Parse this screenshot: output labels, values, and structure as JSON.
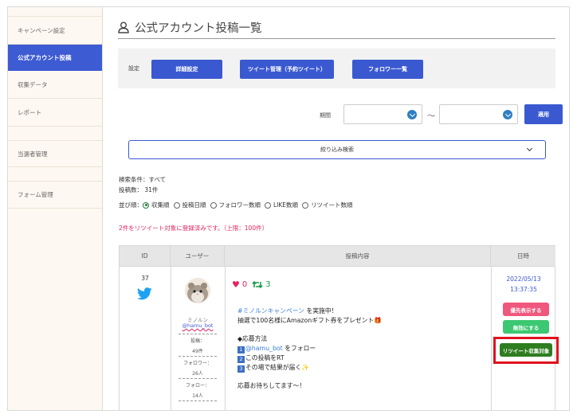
{
  "sidebar": {
    "items": [
      {
        "label": "キャンペーン設定",
        "active": false
      },
      {
        "label": "公式アカウント投稿",
        "active": true
      },
      {
        "label": "収集データ",
        "active": false
      },
      {
        "label": "レポート",
        "active": false
      },
      {
        "label": "当選者管理",
        "active": false
      },
      {
        "label": "フォーム管理",
        "active": false
      }
    ]
  },
  "header": {
    "icon": "user-icon",
    "title": "公式アカウント投稿一覧"
  },
  "settings": {
    "label": "設定",
    "buttons": [
      "詳細設定",
      "ツイート管理（予約ツイート）",
      "フォロワー一覧"
    ]
  },
  "period": {
    "label": "期間",
    "from_value": "",
    "to_value": "",
    "separator": "〜",
    "apply_label": "適用"
  },
  "filter": {
    "label": "絞り込み検索"
  },
  "search_info": {
    "conditions": "検索条件：すべて",
    "count": "投稿数： 31件"
  },
  "sort": {
    "label": "並び順：",
    "options": [
      {
        "label": "収集順",
        "selected": true
      },
      {
        "label": "投稿日順",
        "selected": false
      },
      {
        "label": "フォロワー数順",
        "selected": false
      },
      {
        "label": "LIKE数順",
        "selected": false
      },
      {
        "label": "リツイート数順",
        "selected": false
      }
    ]
  },
  "notice": "2件をリツイート対象に登録済みです。（上限：100件）",
  "table": {
    "headers": [
      "ID",
      "ユーザー",
      "投稿内容",
      "日時"
    ],
    "row": {
      "id": "37",
      "platform_icon": "twitter-icon",
      "user": {
        "name": "ミノルン",
        "handle": "@hamu_bot",
        "stats": [
          {
            "label": "投稿：",
            "value": "49件"
          },
          {
            "label": "フォロワー：",
            "value": "26人"
          },
          {
            "label": "フォロー：",
            "value": "14人"
          }
        ]
      },
      "likes": "0",
      "retweets": "3",
      "post": {
        "hashtag": "#ミノルンキャンペーン",
        "line1_rest": " を実施中！",
        "line2": "抽選で100名様にAmazonギフト券をプレゼント🎁",
        "line3": "◆応募方法",
        "step1_num": "1",
        "step1_mention": "@hamu_bot",
        "step1_rest": " をフォロー",
        "step2_num": "2",
        "step2_text": "この投稿をRT",
        "step3_num": "3",
        "step3_text": "その場で結果が届く✨",
        "line_last": "応募お待ちしてます〜！"
      },
      "date": "2022/05/13",
      "time": "13:37:35",
      "buttons": [
        {
          "label": "優先表示する",
          "color": "#f0577c"
        },
        {
          "label": "無効にする",
          "color": "#3cc872"
        },
        {
          "label": "リツイート収集対象",
          "color": "#2e7d1f"
        }
      ]
    }
  },
  "colors": {
    "accent": "#3a59d1",
    "sidebar_bg": "#fdf8f1",
    "highlight": "#e0131f"
  }
}
